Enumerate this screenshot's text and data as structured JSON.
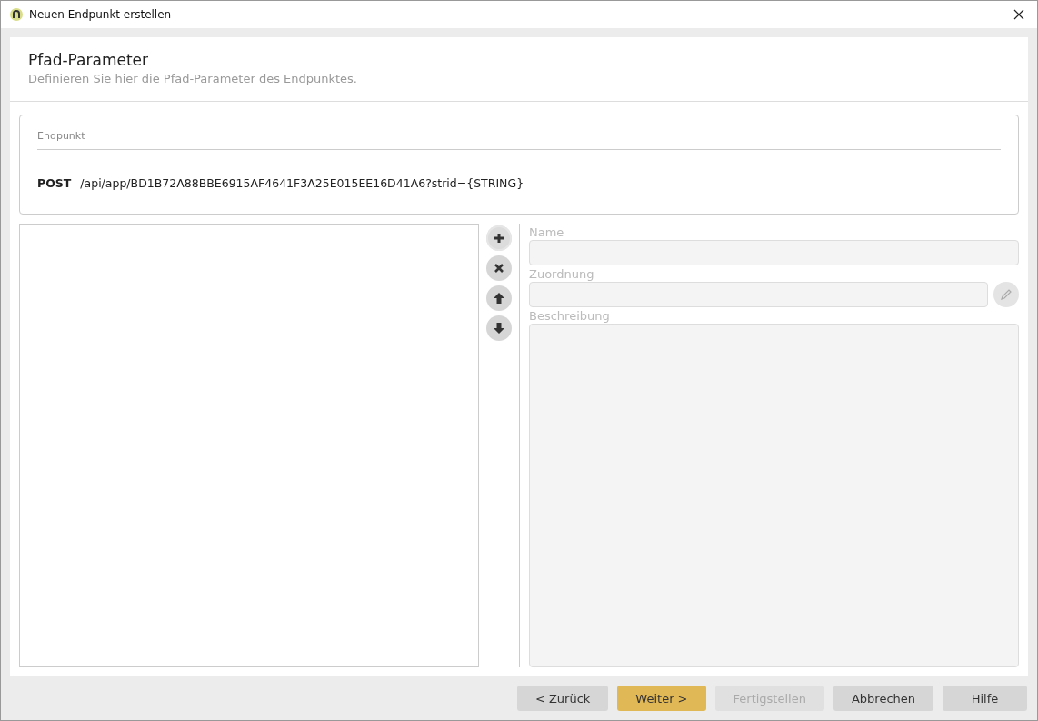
{
  "window": {
    "title": "Neuen Endpunkt erstellen"
  },
  "header": {
    "title": "Pfad-Parameter",
    "subtitle": "Definieren Sie hier die Pfad-Parameter des Endpunktes."
  },
  "endpoint": {
    "label": "Endpunkt",
    "method": "POST",
    "path": "/api/app/BD1B72A88BBE6915AF4641F3A25E015EE16D41A6?strid={STRING}"
  },
  "list_tools": [
    {
      "kind": "add",
      "disabled": false
    },
    {
      "kind": "delete",
      "disabled": true
    },
    {
      "kind": "up",
      "disabled": true
    },
    {
      "kind": "down",
      "disabled": true
    }
  ],
  "fields": [
    {
      "kind": "text",
      "label": "Name",
      "disabled": true
    },
    {
      "kind": "picker",
      "label": "Zuordnung",
      "disabled": true
    },
    {
      "kind": "textarea",
      "label": "Beschreibung",
      "disabled": true
    }
  ],
  "buttons": [
    {
      "label": "< Zurück",
      "primary": false,
      "disabled": false
    },
    {
      "label": "Weiter >",
      "primary": true,
      "disabled": false
    },
    {
      "label": "Fertigstellen",
      "primary": false,
      "disabled": true
    },
    {
      "label": "Abbrechen",
      "primary": false,
      "disabled": false
    },
    {
      "label": "Hilfe",
      "primary": false,
      "disabled": false
    }
  ]
}
